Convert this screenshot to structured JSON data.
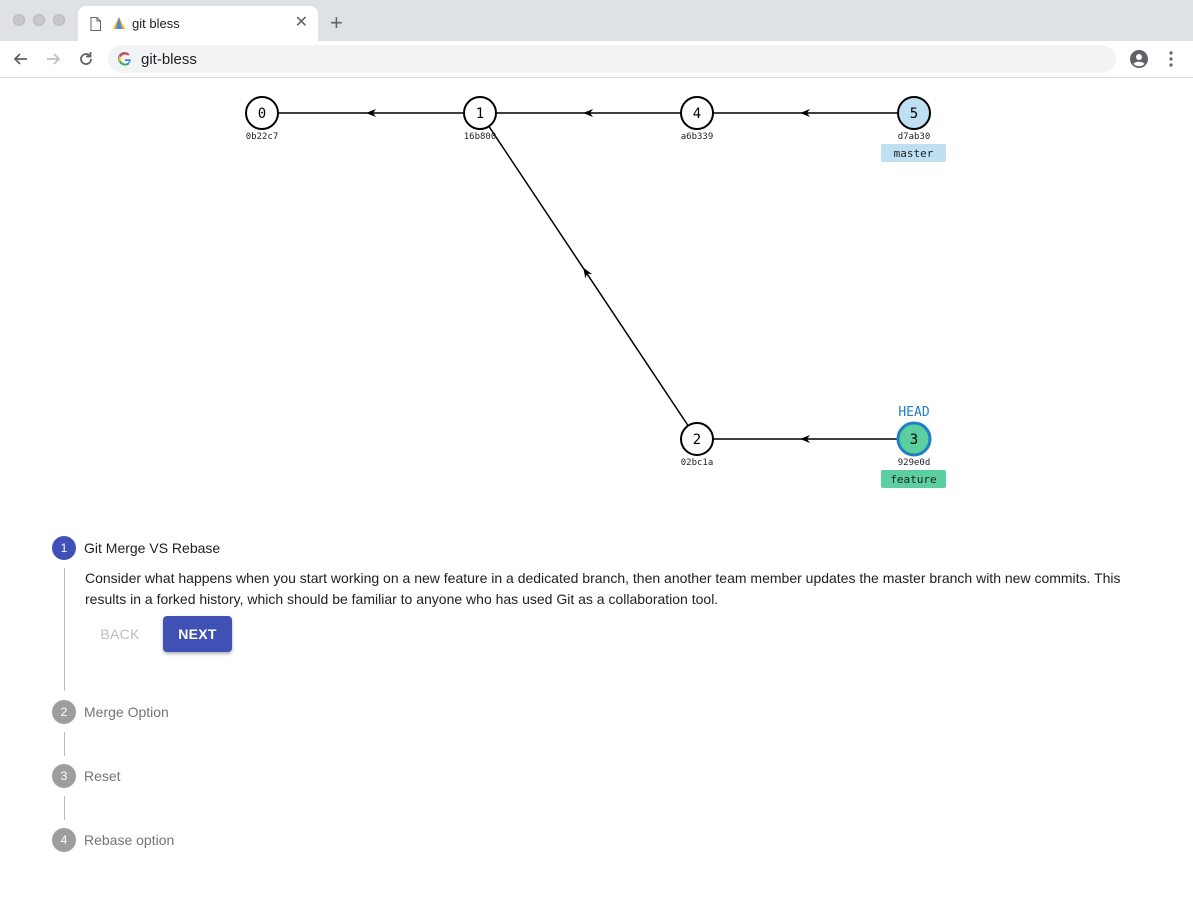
{
  "browser": {
    "tab_title": "git bless",
    "address": "git-bless"
  },
  "graph": {
    "commits": [
      {
        "id": "0",
        "sha": "0b22c7"
      },
      {
        "id": "1",
        "sha": "16b800"
      },
      {
        "id": "4",
        "sha": "a6b339"
      },
      {
        "id": "5",
        "sha": "d7ab30"
      },
      {
        "id": "2",
        "sha": "02bc1a"
      },
      {
        "id": "3",
        "sha": "929e0d"
      }
    ],
    "branches": {
      "master": "master",
      "feature": "feature"
    },
    "head_label": "HEAD",
    "colors": {
      "master_fill": "#bfdff3",
      "feature_fill": "#5ccfa0",
      "head_stroke": "#1e7fc4"
    }
  },
  "stepper": {
    "steps": [
      {
        "number": "1",
        "label": "Git Merge VS Rebase"
      },
      {
        "number": "2",
        "label": "Merge Option"
      },
      {
        "number": "3",
        "label": "Reset"
      },
      {
        "number": "4",
        "label": "Rebase option"
      }
    ],
    "active_description": "Consider what happens when you start working on a new feature in a dedicated branch, then another team member updates the master branch with new commits. This results in a forked history, which should be familiar to anyone who has used Git as a collaboration tool.",
    "back_label": "BACK",
    "next_label": "NEXT"
  }
}
